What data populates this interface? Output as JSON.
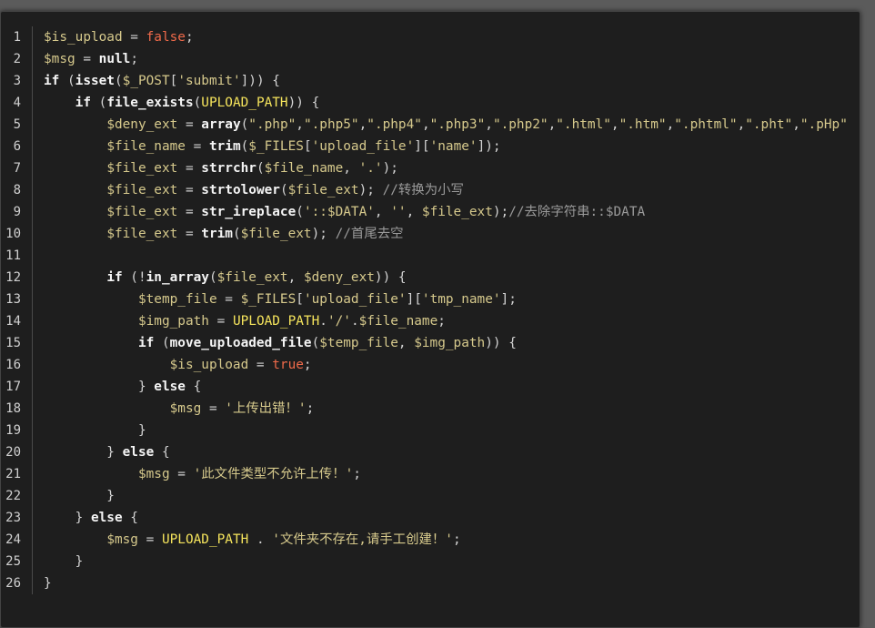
{
  "editor": {
    "line_numbers": [
      "1",
      "2",
      "3",
      "4",
      "5",
      "6",
      "7",
      "8",
      "9",
      "10",
      "11",
      "12",
      "13",
      "14",
      "15",
      "16",
      "17",
      "18",
      "19",
      "20",
      "21",
      "22",
      "23",
      "24",
      "25",
      "26"
    ],
    "lines": [
      [
        {
          "c": "var",
          "t": "$is_upload"
        },
        {
          "c": "op",
          "t": " = "
        },
        {
          "c": "bool",
          "t": "false"
        },
        {
          "c": "pun",
          "t": ";"
        }
      ],
      [
        {
          "c": "var",
          "t": "$msg"
        },
        {
          "c": "op",
          "t": " = "
        },
        {
          "c": "key",
          "t": "null"
        },
        {
          "c": "pun",
          "t": ";"
        }
      ],
      [
        {
          "c": "key",
          "t": "if"
        },
        {
          "c": "pun",
          "t": " ("
        },
        {
          "c": "fn",
          "t": "isset"
        },
        {
          "c": "pun",
          "t": "("
        },
        {
          "c": "var",
          "t": "$_POST"
        },
        {
          "c": "pun",
          "t": "["
        },
        {
          "c": "str",
          "t": "'submit'"
        },
        {
          "c": "pun",
          "t": "])) {"
        }
      ],
      [
        {
          "c": "pun",
          "t": "    "
        },
        {
          "c": "key",
          "t": "if"
        },
        {
          "c": "pun",
          "t": " ("
        },
        {
          "c": "fn",
          "t": "file_exists"
        },
        {
          "c": "pun",
          "t": "("
        },
        {
          "c": "const",
          "t": "UPLOAD_PATH"
        },
        {
          "c": "pun",
          "t": ")) {"
        }
      ],
      [
        {
          "c": "pun",
          "t": "        "
        },
        {
          "c": "var",
          "t": "$deny_ext"
        },
        {
          "c": "op",
          "t": " = "
        },
        {
          "c": "fn",
          "t": "array"
        },
        {
          "c": "pun",
          "t": "("
        },
        {
          "c": "str",
          "t": "\".php\""
        },
        {
          "c": "pun",
          "t": ","
        },
        {
          "c": "str",
          "t": "\".php5\""
        },
        {
          "c": "pun",
          "t": ","
        },
        {
          "c": "str",
          "t": "\".php4\""
        },
        {
          "c": "pun",
          "t": ","
        },
        {
          "c": "str",
          "t": "\".php3\""
        },
        {
          "c": "pun",
          "t": ","
        },
        {
          "c": "str",
          "t": "\".php2\""
        },
        {
          "c": "pun",
          "t": ","
        },
        {
          "c": "str",
          "t": "\".html\""
        },
        {
          "c": "pun",
          "t": ","
        },
        {
          "c": "str",
          "t": "\".htm\""
        },
        {
          "c": "pun",
          "t": ","
        },
        {
          "c": "str",
          "t": "\".phtml\""
        },
        {
          "c": "pun",
          "t": ","
        },
        {
          "c": "str",
          "t": "\".pht\""
        },
        {
          "c": "pun",
          "t": ","
        },
        {
          "c": "str",
          "t": "\".pHp\""
        }
      ],
      [
        {
          "c": "pun",
          "t": "        "
        },
        {
          "c": "var",
          "t": "$file_name"
        },
        {
          "c": "op",
          "t": " = "
        },
        {
          "c": "fn",
          "t": "trim"
        },
        {
          "c": "pun",
          "t": "("
        },
        {
          "c": "var",
          "t": "$_FILES"
        },
        {
          "c": "pun",
          "t": "["
        },
        {
          "c": "str",
          "t": "'upload_file'"
        },
        {
          "c": "pun",
          "t": "]["
        },
        {
          "c": "str",
          "t": "'name'"
        },
        {
          "c": "pun",
          "t": "]);"
        }
      ],
      [
        {
          "c": "pun",
          "t": "        "
        },
        {
          "c": "var",
          "t": "$file_ext"
        },
        {
          "c": "op",
          "t": " = "
        },
        {
          "c": "fn",
          "t": "strrchr"
        },
        {
          "c": "pun",
          "t": "("
        },
        {
          "c": "var",
          "t": "$file_name"
        },
        {
          "c": "pun",
          "t": ", "
        },
        {
          "c": "str",
          "t": "'.'"
        },
        {
          "c": "pun",
          "t": ");"
        }
      ],
      [
        {
          "c": "pun",
          "t": "        "
        },
        {
          "c": "var",
          "t": "$file_ext"
        },
        {
          "c": "op",
          "t": " = "
        },
        {
          "c": "fn",
          "t": "strtolower"
        },
        {
          "c": "pun",
          "t": "("
        },
        {
          "c": "var",
          "t": "$file_ext"
        },
        {
          "c": "pun",
          "t": "); "
        },
        {
          "c": "cmt",
          "t": "//转换为小写"
        }
      ],
      [
        {
          "c": "pun",
          "t": "        "
        },
        {
          "c": "var",
          "t": "$file_ext"
        },
        {
          "c": "op",
          "t": " = "
        },
        {
          "c": "fn",
          "t": "str_ireplace"
        },
        {
          "c": "pun",
          "t": "("
        },
        {
          "c": "str",
          "t": "'::$DATA'"
        },
        {
          "c": "pun",
          "t": ", "
        },
        {
          "c": "str",
          "t": "''"
        },
        {
          "c": "pun",
          "t": ", "
        },
        {
          "c": "var",
          "t": "$file_ext"
        },
        {
          "c": "pun",
          "t": ");"
        },
        {
          "c": "cmt",
          "t": "//去除字符串::$DATA"
        }
      ],
      [
        {
          "c": "pun",
          "t": "        "
        },
        {
          "c": "var",
          "t": "$file_ext"
        },
        {
          "c": "op",
          "t": " = "
        },
        {
          "c": "fn",
          "t": "trim"
        },
        {
          "c": "pun",
          "t": "("
        },
        {
          "c": "var",
          "t": "$file_ext"
        },
        {
          "c": "pun",
          "t": "); "
        },
        {
          "c": "cmt",
          "t": "//首尾去空"
        }
      ],
      [],
      [
        {
          "c": "pun",
          "t": "        "
        },
        {
          "c": "key",
          "t": "if"
        },
        {
          "c": "pun",
          "t": " (!"
        },
        {
          "c": "fn",
          "t": "in_array"
        },
        {
          "c": "pun",
          "t": "("
        },
        {
          "c": "var",
          "t": "$file_ext"
        },
        {
          "c": "pun",
          "t": ", "
        },
        {
          "c": "var",
          "t": "$deny_ext"
        },
        {
          "c": "pun",
          "t": ")) {"
        }
      ],
      [
        {
          "c": "pun",
          "t": "            "
        },
        {
          "c": "var",
          "t": "$temp_file"
        },
        {
          "c": "op",
          "t": " = "
        },
        {
          "c": "var",
          "t": "$_FILES"
        },
        {
          "c": "pun",
          "t": "["
        },
        {
          "c": "str",
          "t": "'upload_file'"
        },
        {
          "c": "pun",
          "t": "]["
        },
        {
          "c": "str",
          "t": "'tmp_name'"
        },
        {
          "c": "pun",
          "t": "];"
        }
      ],
      [
        {
          "c": "pun",
          "t": "            "
        },
        {
          "c": "var",
          "t": "$img_path"
        },
        {
          "c": "op",
          "t": " = "
        },
        {
          "c": "const",
          "t": "UPLOAD_PATH"
        },
        {
          "c": "pun",
          "t": "."
        },
        {
          "c": "str",
          "t": "'/'"
        },
        {
          "c": "pun",
          "t": "."
        },
        {
          "c": "var",
          "t": "$file_name"
        },
        {
          "c": "pun",
          "t": ";"
        }
      ],
      [
        {
          "c": "pun",
          "t": "            "
        },
        {
          "c": "key",
          "t": "if"
        },
        {
          "c": "pun",
          "t": " ("
        },
        {
          "c": "fn",
          "t": "move_uploaded_file"
        },
        {
          "c": "pun",
          "t": "("
        },
        {
          "c": "var",
          "t": "$temp_file"
        },
        {
          "c": "pun",
          "t": ", "
        },
        {
          "c": "var",
          "t": "$img_path"
        },
        {
          "c": "pun",
          "t": ")) {"
        }
      ],
      [
        {
          "c": "pun",
          "t": "                "
        },
        {
          "c": "var",
          "t": "$is_upload"
        },
        {
          "c": "op",
          "t": " = "
        },
        {
          "c": "bool",
          "t": "true"
        },
        {
          "c": "pun",
          "t": ";"
        }
      ],
      [
        {
          "c": "pun",
          "t": "            } "
        },
        {
          "c": "key",
          "t": "else"
        },
        {
          "c": "pun",
          "t": " {"
        }
      ],
      [
        {
          "c": "pun",
          "t": "                "
        },
        {
          "c": "var",
          "t": "$msg"
        },
        {
          "c": "op",
          "t": " = "
        },
        {
          "c": "str",
          "t": "'上传出错！'"
        },
        {
          "c": "pun",
          "t": ";"
        }
      ],
      [
        {
          "c": "pun",
          "t": "            }"
        }
      ],
      [
        {
          "c": "pun",
          "t": "        } "
        },
        {
          "c": "key",
          "t": "else"
        },
        {
          "c": "pun",
          "t": " {"
        }
      ],
      [
        {
          "c": "pun",
          "t": "            "
        },
        {
          "c": "var",
          "t": "$msg"
        },
        {
          "c": "op",
          "t": " = "
        },
        {
          "c": "str",
          "t": "'此文件类型不允许上传！'"
        },
        {
          "c": "pun",
          "t": ";"
        }
      ],
      [
        {
          "c": "pun",
          "t": "        }"
        }
      ],
      [
        {
          "c": "pun",
          "t": "    } "
        },
        {
          "c": "key",
          "t": "else"
        },
        {
          "c": "pun",
          "t": " {"
        }
      ],
      [
        {
          "c": "pun",
          "t": "        "
        },
        {
          "c": "var",
          "t": "$msg"
        },
        {
          "c": "op",
          "t": " = "
        },
        {
          "c": "const",
          "t": "UPLOAD_PATH"
        },
        {
          "c": "pun",
          "t": " . "
        },
        {
          "c": "str",
          "t": "'文件夹不存在,请手工创建！'"
        },
        {
          "c": "pun",
          "t": ";"
        }
      ],
      [
        {
          "c": "pun",
          "t": "    }"
        }
      ],
      [
        {
          "c": "pun",
          "t": "}"
        }
      ]
    ]
  }
}
